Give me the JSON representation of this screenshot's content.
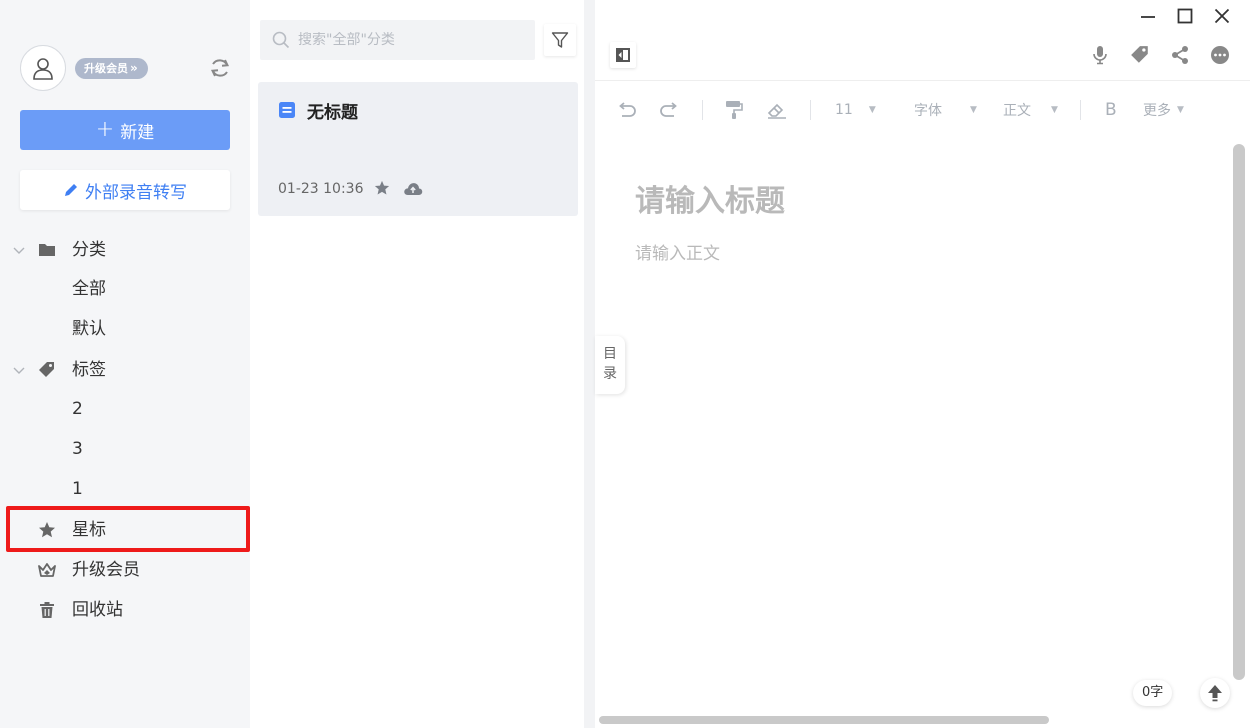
{
  "sidebar": {
    "vip_badge": "升级会员",
    "vip_chevron": "»",
    "new_button": "新建",
    "new_button_plus": "+",
    "record_button": "外部录音转写",
    "categories": {
      "label": "分类",
      "items": [
        "全部",
        "默认"
      ]
    },
    "tags": {
      "label": "标签",
      "items": [
        "2",
        "3",
        "1"
      ]
    },
    "starred": "星标",
    "upgrade": "升级会员",
    "trash": "回收站"
  },
  "list": {
    "search_placeholder": "搜索\"全部\"分类",
    "note": {
      "title": "无标题",
      "time": "01-23 10:36"
    }
  },
  "editor": {
    "toolbar": {
      "font_size": "11",
      "font_family": "字体",
      "paragraph": "正文",
      "bold": "B",
      "more": "更多",
      "dropdown_glyph": "▼"
    },
    "title_placeholder": "请输入标题",
    "body_placeholder": "请输入正文",
    "toc_line1": "目",
    "toc_line2": "录",
    "word_count": "0字"
  },
  "colors": {
    "accent": "#6b9cf7",
    "link_blue": "#3f7ff3",
    "highlight_red": "#ee1a1a",
    "sidebar_bg": "#f5f6f8",
    "card_bg": "#eef0f4"
  }
}
